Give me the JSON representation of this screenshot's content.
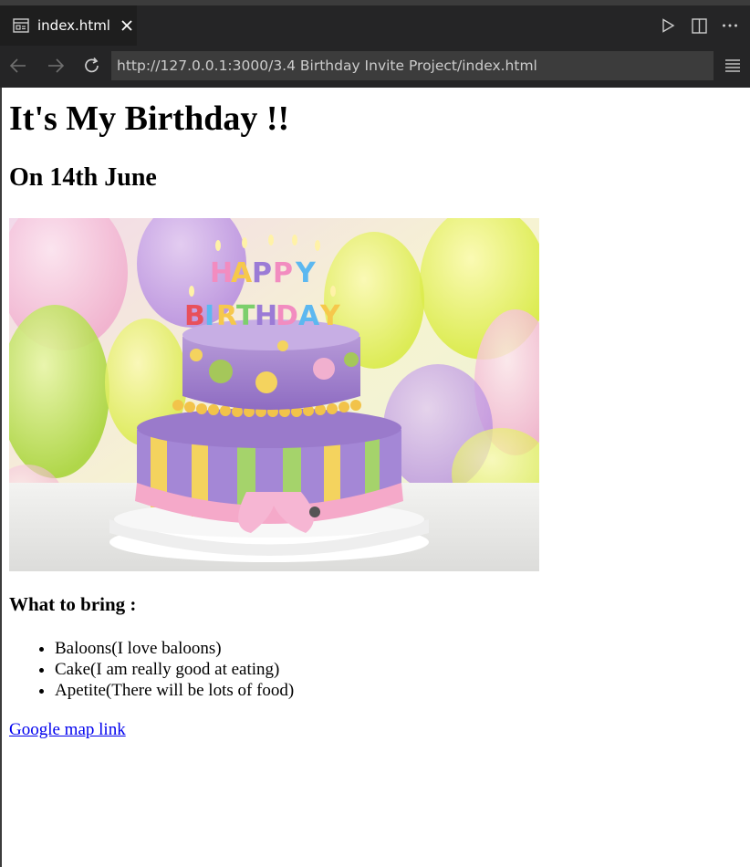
{
  "tab": {
    "label": "index.html"
  },
  "address_bar": {
    "url": "http://127.0.0.1:3000/3.4 Birthday Invite Project/index.html"
  },
  "page": {
    "heading": "It's My Birthday !!",
    "subheading": "On 14th June",
    "image_subject": "Birthday cake with HAPPY BIRTHDAY candles and balloons",
    "bring_heading": "What to bring :",
    "bring_items": [
      "Baloons(I love baloons)",
      "Cake(I am really good at eating)",
      "Apetite(There will be lots of food)"
    ],
    "map_link": "Google map link"
  },
  "icons": [
    "preview-icon",
    "close-icon",
    "run-icon",
    "split-editor-icon",
    "more-icon",
    "back-icon",
    "forward-icon",
    "reload-icon",
    "menu-icon"
  ],
  "colors": {
    "chrome_bg": "#252526",
    "active_tab_bg": "#1e1e1e",
    "url_bg": "#3c3c3c",
    "link": "#0000ee"
  }
}
